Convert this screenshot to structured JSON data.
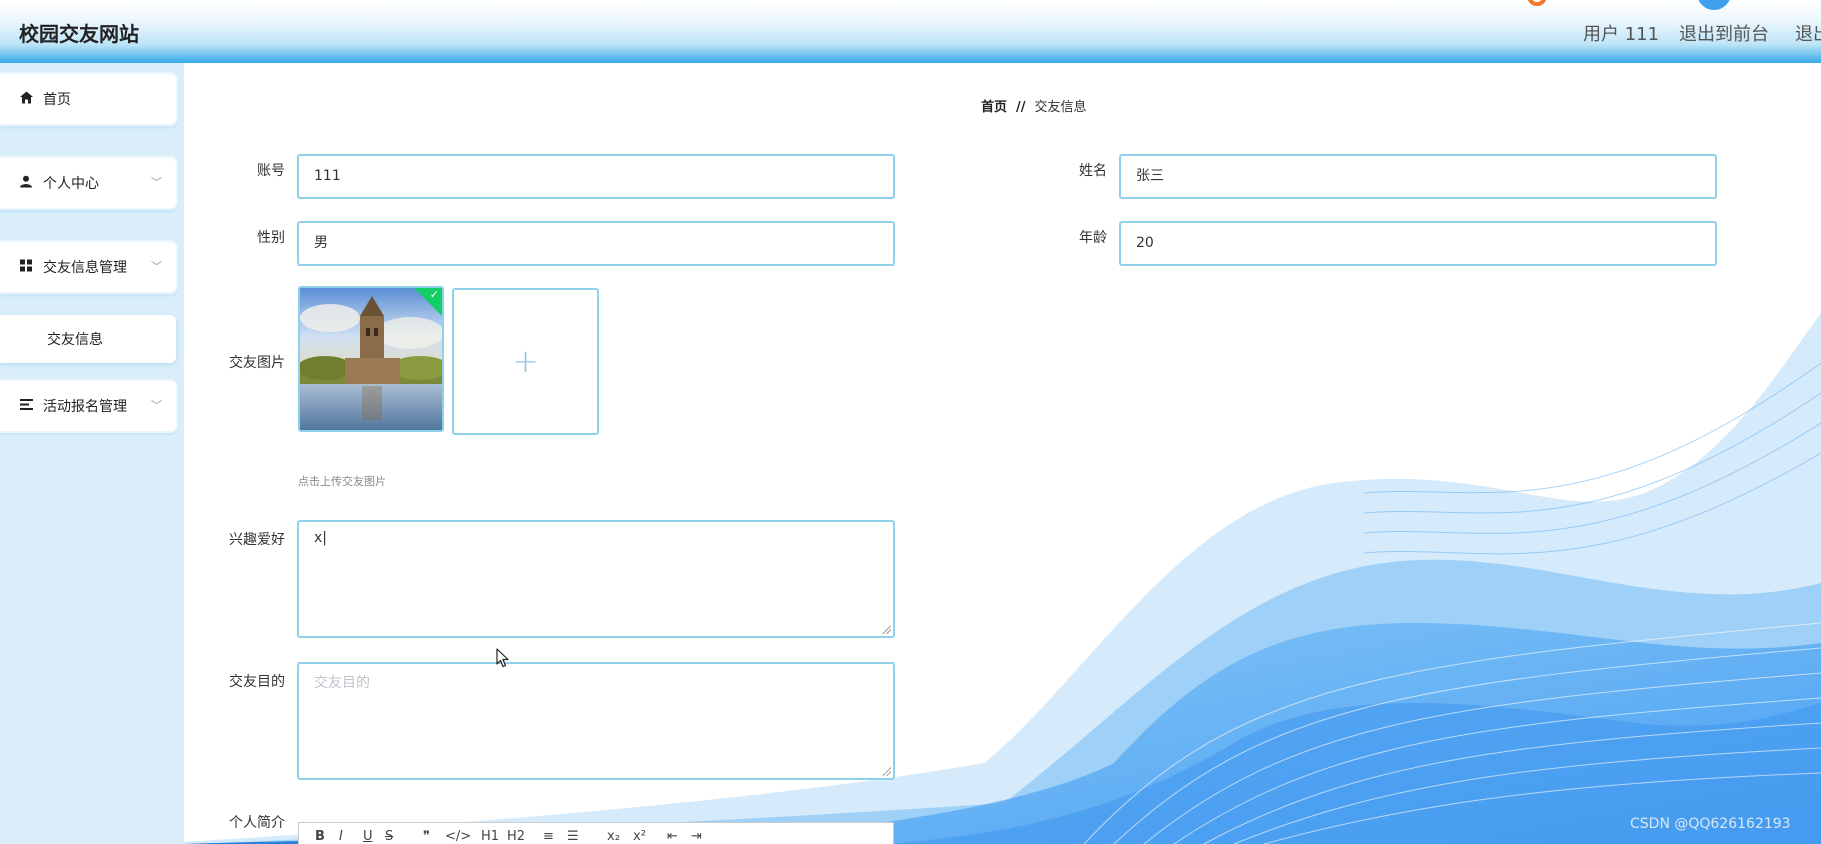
{
  "header": {
    "site_title": "校园交友网站",
    "user_label": "用户 111",
    "exit_front": "退出到前台",
    "exit": "退出"
  },
  "sidebar": {
    "items": [
      {
        "label": "首页",
        "icon": "home-icon"
      },
      {
        "label": "个人中心",
        "icon": "user-icon",
        "expandable": true
      },
      {
        "label": "交友信息管理",
        "icon": "grid-icon",
        "expandable": true,
        "expanded": true
      },
      {
        "label": "交友信息",
        "submenu": true
      },
      {
        "label": "活动报名管理",
        "icon": "list-icon",
        "expandable": true
      }
    ]
  },
  "breadcrumb": {
    "home": "首页",
    "separator": "//",
    "current": "交友信息"
  },
  "form": {
    "account": {
      "label": "账号",
      "value": "111"
    },
    "name": {
      "label": "姓名",
      "value": "张三"
    },
    "gender": {
      "label": "性别",
      "value": "男"
    },
    "age": {
      "label": "年龄",
      "value": "20"
    },
    "photo": {
      "label": "交友图片",
      "hint": "点击上传交友图片",
      "upload_symbol": "+"
    },
    "hobby": {
      "label": "兴趣爱好",
      "value": "x|"
    },
    "purpose": {
      "label": "交友目的",
      "placeholder": "交友目的"
    },
    "intro": {
      "label": "个人简介"
    }
  },
  "editor_toolbar": [
    "B",
    "I",
    "U",
    "S",
    "❞",
    "</>",
    "H1",
    "H2",
    "≡",
    "☰",
    "x₂",
    "x²",
    "⇤",
    "⇥"
  ],
  "watermark": "CSDN @QQ626162193",
  "colors": {
    "accent": "#35a9e8",
    "border": "#8fd0ea",
    "sidebar_bg": "#d9eef9",
    "success": "#13ce66"
  }
}
